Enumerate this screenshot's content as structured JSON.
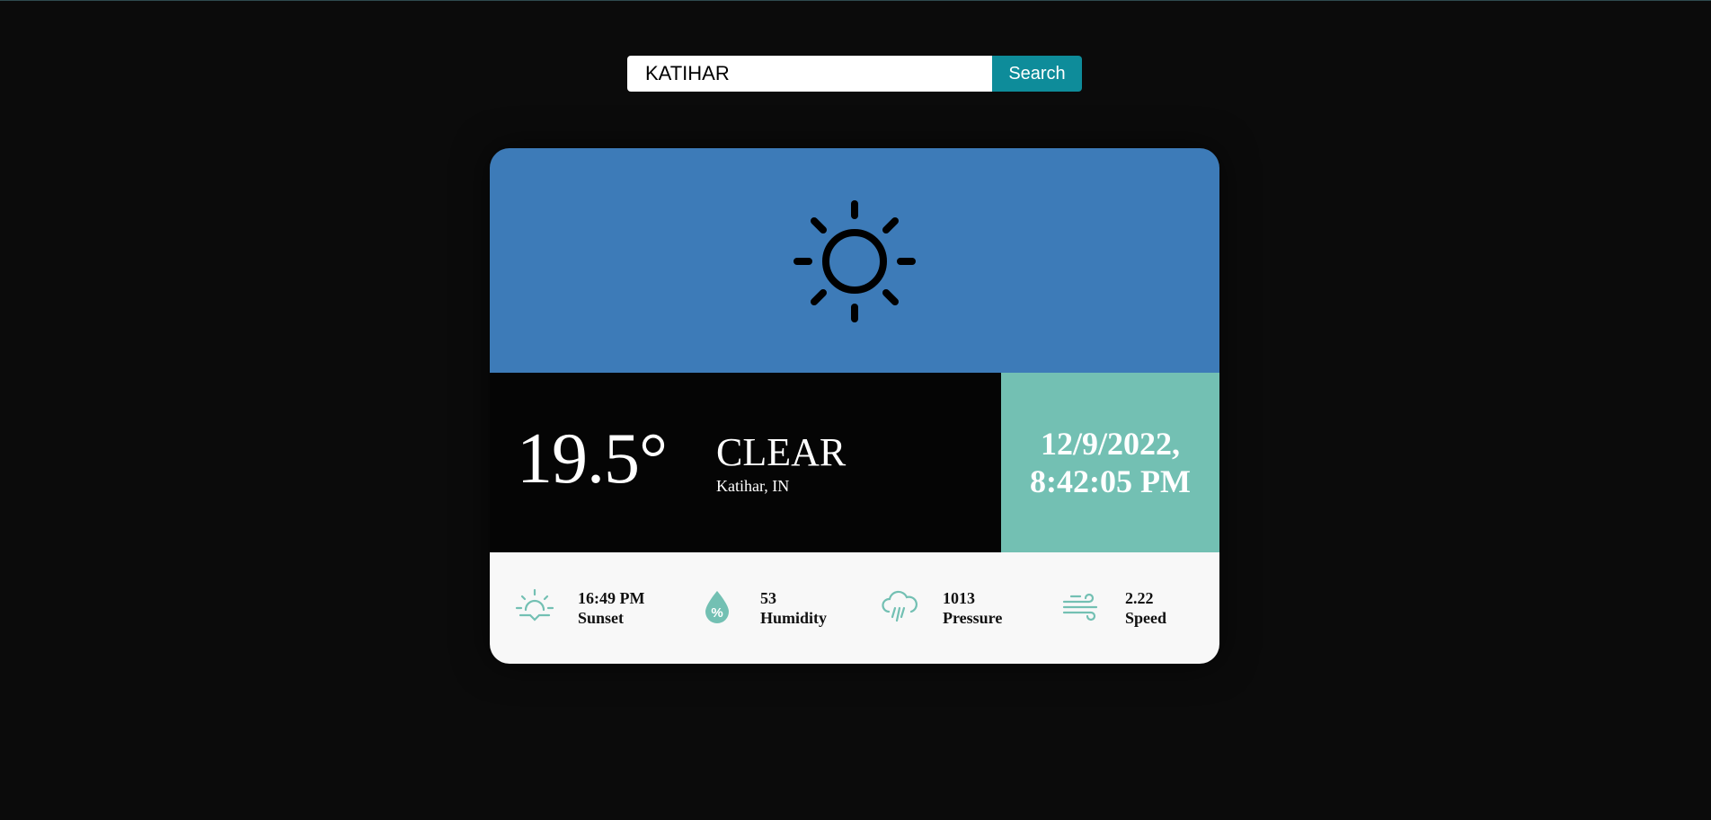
{
  "search": {
    "value": "KATIHAR",
    "placeholder": "",
    "button_label": "Search"
  },
  "weather": {
    "icon": "sun-icon",
    "temperature": "19.5°",
    "condition": "CLEAR",
    "location": "Katihar, IN",
    "date": "12/9/2022,",
    "time": "8:42:05 PM"
  },
  "stats": [
    {
      "icon": "sunset-icon",
      "value": "16:49 PM",
      "label": "Sunset"
    },
    {
      "icon": "humidity-icon",
      "value": "53",
      "label": "Humidity"
    },
    {
      "icon": "pressure-icon",
      "value": "1013",
      "label": "Pressure"
    },
    {
      "icon": "wind-icon",
      "value": "2.22",
      "label": "Speed"
    }
  ],
  "colors": {
    "background": "#0b0b0b",
    "card_top": "#3d7bb8",
    "accent": "#73c0b3",
    "search_button": "#0e8c9a"
  }
}
